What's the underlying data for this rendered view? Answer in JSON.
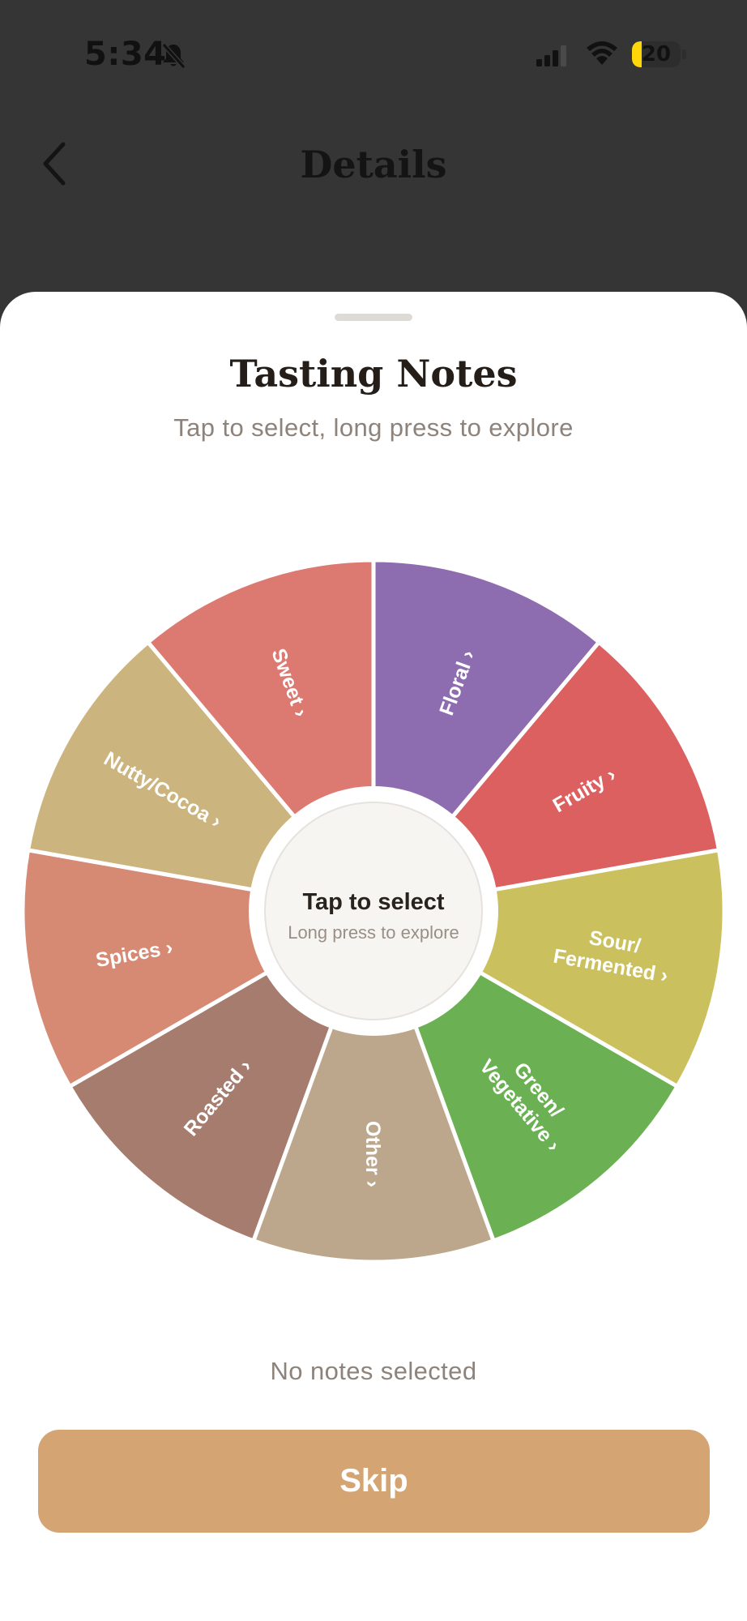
{
  "status_bar": {
    "time": "5:34",
    "battery_level": "20",
    "battery_fraction": 0.2,
    "icons": [
      "bell-slash-icon",
      "cellular-signal-icon",
      "wifi-icon",
      "battery-icon"
    ]
  },
  "nav": {
    "title": "Details",
    "back_icon": "chevron-left-icon"
  },
  "sheet": {
    "title": "Tasting Notes",
    "subtitle": "Tap to select, long press to explore",
    "status": "No notes selected",
    "skip_label": "Skip"
  },
  "wheel": {
    "center": {
      "title": "Tap to select",
      "subtitle": "Long press to explore"
    },
    "segments": [
      {
        "name": "floral",
        "lines": [
          "Floral"
        ],
        "color": "#8e6cb0"
      },
      {
        "name": "fruity",
        "lines": [
          "Fruity"
        ],
        "color": "#dc6060"
      },
      {
        "name": "sour",
        "lines": [
          "Sour/",
          "Fermented"
        ],
        "color": "#cbc05e"
      },
      {
        "name": "green",
        "lines": [
          "Green/",
          "Vegetative"
        ],
        "color": "#6bb053"
      },
      {
        "name": "other",
        "lines": [
          "Other"
        ],
        "color": "#bda78c"
      },
      {
        "name": "roasted",
        "lines": [
          "Roasted"
        ],
        "color": "#a57c6e"
      },
      {
        "name": "spices",
        "lines": [
          "Spices"
        ],
        "color": "#d68a74"
      },
      {
        "name": "nutty",
        "lines": [
          "Nutty/Cocoa"
        ],
        "color": "#cbb47d"
      },
      {
        "name": "sweet",
        "lines": [
          "Sweet"
        ],
        "color": "#dc7a71"
      }
    ]
  }
}
